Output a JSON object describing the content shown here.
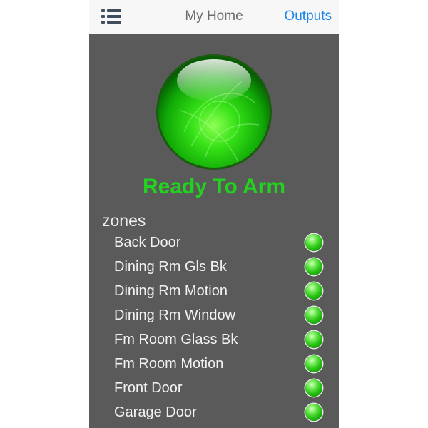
{
  "navbar": {
    "title": "My Home",
    "right_link": "Outputs",
    "menu_icon": "list-menu-icon"
  },
  "status": {
    "text": "Ready To Arm",
    "color": "#22d21e",
    "indicator_icon": "green-status-orb"
  },
  "zones": {
    "header": "zones",
    "items": [
      {
        "name": "Back Door",
        "state": "ready",
        "led_color": "#29c414"
      },
      {
        "name": "Dining Rm Gls Bk",
        "state": "ready",
        "led_color": "#29c414"
      },
      {
        "name": "Dining Rm Motion",
        "state": "ready",
        "led_color": "#29c414"
      },
      {
        "name": "Dining Rm Window",
        "state": "ready",
        "led_color": "#29c414"
      },
      {
        "name": "Fm Room Glass Bk",
        "state": "ready",
        "led_color": "#29c414"
      },
      {
        "name": "Fm Room Motion",
        "state": "ready",
        "led_color": "#29c414"
      },
      {
        "name": "Front Door",
        "state": "ready",
        "led_color": "#29c414"
      },
      {
        "name": "Garage Door",
        "state": "ready",
        "led_color": "#29c414"
      }
    ]
  },
  "colors": {
    "background": "#5a5a5a",
    "navbar": "#f7f7f7",
    "link": "#1a86e8"
  }
}
